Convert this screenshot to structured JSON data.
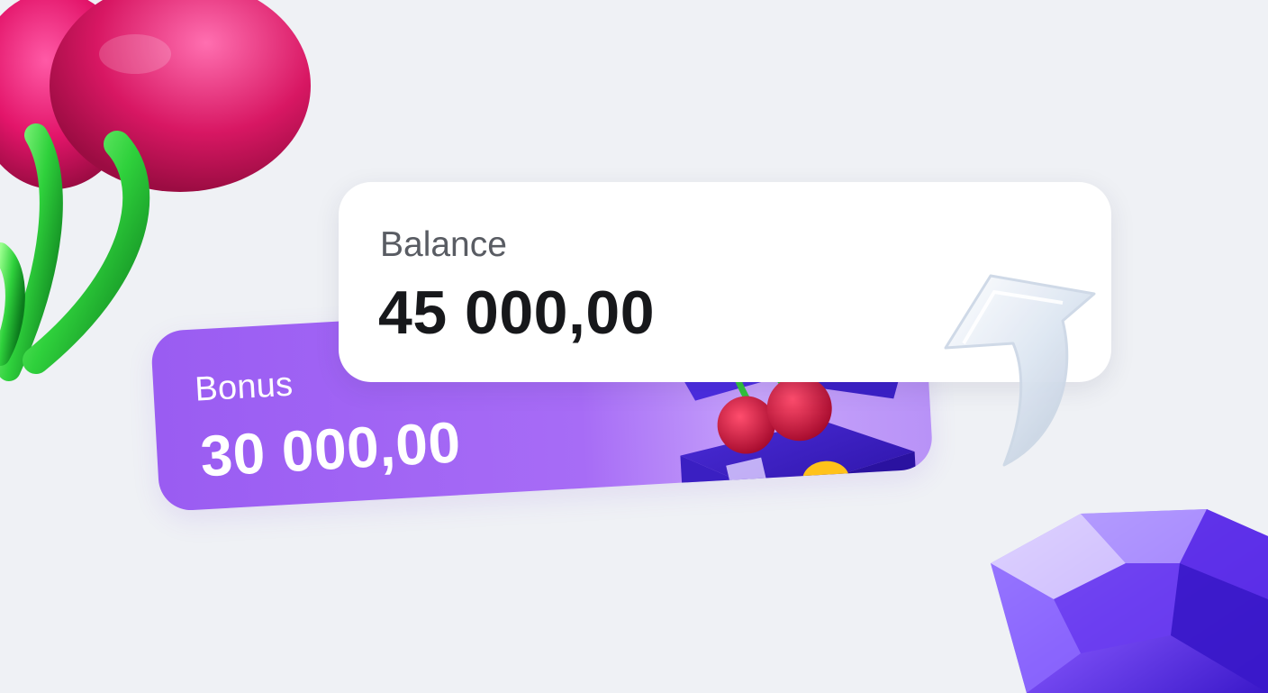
{
  "balance": {
    "label": "Balance",
    "value": "45 000,00"
  },
  "bonus": {
    "label": "Bonus",
    "value": "30 000,00"
  },
  "decorations": {
    "top_left": "cherry-illustration",
    "gift": "gift-box-with-cherry-illustration",
    "arrow": "glass-up-arrow-icon",
    "bottom_right": "purple-gem-illustration"
  },
  "colors": {
    "background": "#eff1f5",
    "bonus_card": "#9a5cf2",
    "balance_card": "#ffffff",
    "cherry": "#e3156a",
    "stem": "#2fd13c",
    "gem": "#6a3cf0"
  }
}
